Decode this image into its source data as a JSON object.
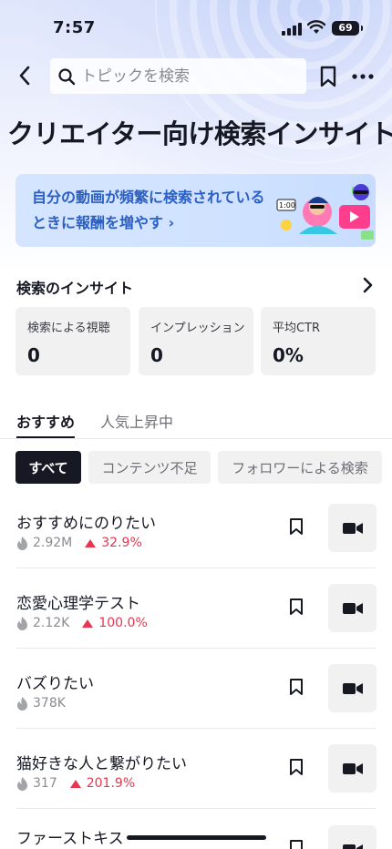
{
  "status_bar": {
    "time": "7:57",
    "battery": "69"
  },
  "search": {
    "placeholder": "トピックを検索"
  },
  "page": {
    "title": "クリエイター向け検索インサイト"
  },
  "banner": {
    "text": "自分の動画が頻繁に検索されているときに報酬を増やす ›",
    "art_time_label": "1:00"
  },
  "insights": {
    "title": "検索のインサイト",
    "cards": [
      {
        "label": "検索による視聴",
        "value": "0"
      },
      {
        "label": "インプレッション",
        "value": "0"
      },
      {
        "label": "平均CTR",
        "value": "0%"
      }
    ]
  },
  "tabs": [
    {
      "label": "おすすめ",
      "active": true
    },
    {
      "label": "人気上昇中",
      "active": false
    }
  ],
  "chips": [
    {
      "label": "すべて",
      "active": true
    },
    {
      "label": "コンテンツ不足",
      "active": false
    },
    {
      "label": "フォロワーによる検索",
      "active": false
    }
  ],
  "topics": [
    {
      "title": "おすすめにのりたい",
      "views": "2.92M",
      "trend": "32.9%"
    },
    {
      "title": "恋愛心理学テスト",
      "views": "2.12K",
      "trend": "100.0%"
    },
    {
      "title": "バズりたい",
      "views": "378K",
      "trend": ""
    },
    {
      "title": "猫好きな人と繋がりたい",
      "views": "317",
      "trend": "201.9%"
    },
    {
      "title": "ファーストキス",
      "views": "",
      "trend": ""
    }
  ],
  "colors": {
    "accent_trend": "#e8364f",
    "banner_text": "#2b5fc4",
    "dark": "#161823"
  }
}
